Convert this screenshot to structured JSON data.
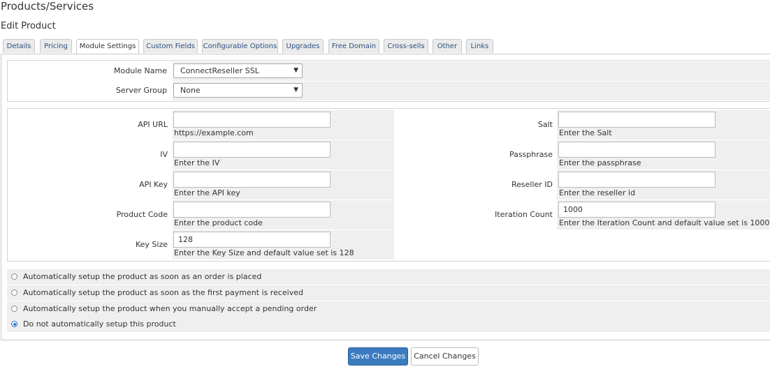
{
  "header": {
    "title": "Products/Services",
    "subtitle": "Edit Product"
  },
  "tabs": [
    {
      "label": "Details"
    },
    {
      "label": "Pricing"
    },
    {
      "label": "Module Settings"
    },
    {
      "label": "Custom Fields"
    },
    {
      "label": "Configurable Options"
    },
    {
      "label": "Upgrades"
    },
    {
      "label": "Free Domain"
    },
    {
      "label": "Cross-sells"
    },
    {
      "label": "Other"
    },
    {
      "label": "Links"
    }
  ],
  "module": {
    "module_name_label": "Module Name",
    "module_name_value": "ConnectReseller SSL",
    "server_group_label": "Server Group",
    "server_group_value": "None"
  },
  "fields": {
    "api_url": {
      "label": "API URL",
      "value": "",
      "help": "https://example.com"
    },
    "iv": {
      "label": "IV",
      "value": "",
      "help": "Enter the IV"
    },
    "api_key": {
      "label": "API Key",
      "value": "",
      "help": "Enter the API key"
    },
    "product_code": {
      "label": "Product Code",
      "value": "",
      "help": "Enter the product code"
    },
    "key_size": {
      "label": "Key Size",
      "value": "128",
      "help": "Enter the Key Size and default value set is 128"
    },
    "salt": {
      "label": "Salt",
      "value": "",
      "help": "Enter the Salt"
    },
    "passphrase": {
      "label": "Passphrase",
      "value": "",
      "help": "Enter the passphrase"
    },
    "reseller_id": {
      "label": "Reseller ID",
      "value": "",
      "help": "Enter the reseller id"
    },
    "iteration_count": {
      "label": "Iteration Count",
      "value": "1000",
      "help": "Enter the Iteration Count and default value set is 1000"
    }
  },
  "setup_options": [
    {
      "label": "Automatically setup the product as soon as an order is placed",
      "checked": false
    },
    {
      "label": "Automatically setup the product as soon as the first payment is received",
      "checked": false
    },
    {
      "label": "Automatically setup the product when you manually accept a pending order",
      "checked": false
    },
    {
      "label": "Do not automatically setup this product",
      "checked": true
    }
  ],
  "buttons": {
    "save": "Save Changes",
    "cancel": "Cancel Changes"
  },
  "colors": {
    "primary": "#3b7bbf",
    "panel_grey": "#efefef",
    "tab_link": "#2a4f7f"
  }
}
